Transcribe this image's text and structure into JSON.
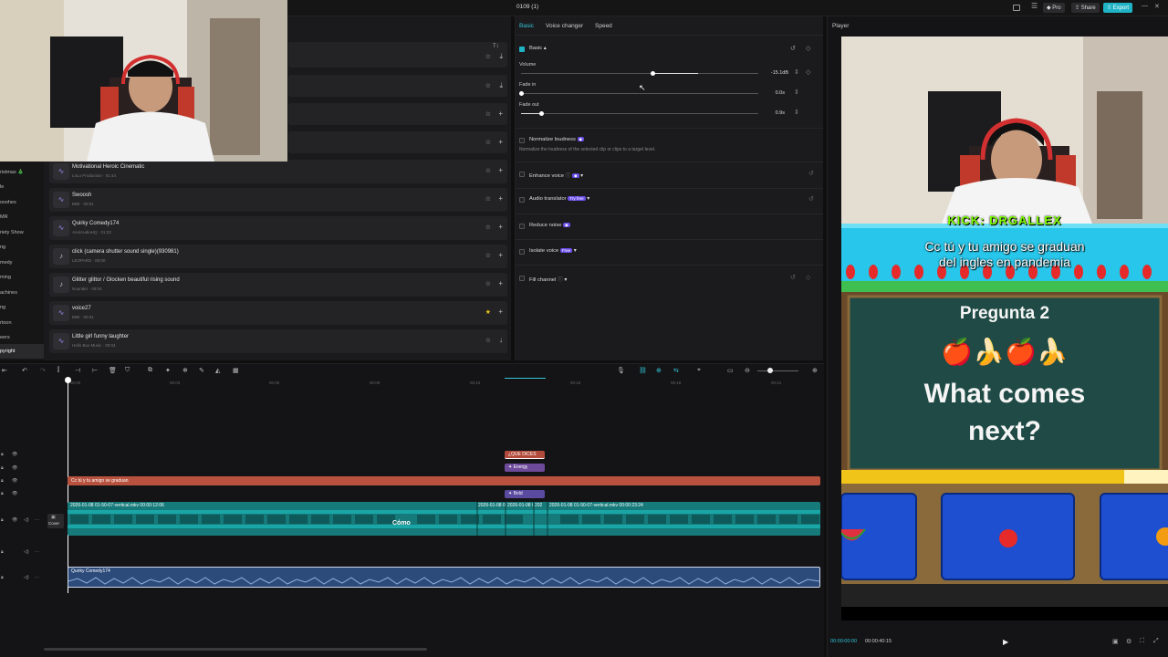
{
  "project": {
    "title": "0109 (1)",
    "pro_label": "Pro",
    "share_label": "Share",
    "export_label": "Export"
  },
  "library": {
    "sort_label": "T↕",
    "categories": [
      "ristmas",
      "le",
      "ooshes",
      "MR",
      "riety Show",
      "ng",
      "medy",
      "ming",
      "achines",
      "ng",
      "rtoon",
      "eers",
      "pyright"
    ],
    "christmas_suffix": "🎄",
    "items": [
      {
        "name": "Motivational Heroic Cinematic",
        "meta": "LoLo Production · 01:44",
        "starred": false,
        "action": "+"
      },
      {
        "name": "Swoosh",
        "meta": "BIBI · 00:01",
        "starred": false,
        "action": "+"
      },
      {
        "name": "Quirky Comedy174",
        "meta": "AnotAudioHQ · 01:23",
        "starred": false,
        "action": "+"
      },
      {
        "name": "click (camera shutter sound single)(930981)",
        "meta": "LEOPARD · 00:00",
        "starred": false,
        "action": "+"
      },
      {
        "name": "Glitter glittor / Glocken beautiful rising sound",
        "meta": "Nounder · 00:04",
        "starred": false,
        "action": "+"
      },
      {
        "name": "voice27",
        "meta": "BIBI · 00:01",
        "starred": true,
        "action": "+"
      },
      {
        "name": "Little girl funny laughter",
        "meta": "Hello Box Music · 00:04",
        "starred": false,
        "action": "↓"
      }
    ]
  },
  "props": {
    "tabs": [
      "Basic",
      "Voice changer",
      "Speed"
    ],
    "basic_label": "Basic",
    "volume": {
      "label": "Volume",
      "value": "-15.1dB",
      "level": 0.45
    },
    "fade_in": {
      "label": "Fade in",
      "value": "0.0s",
      "level": 0.0
    },
    "fade_out": {
      "label": "Fade out",
      "value": "0.9s",
      "level": 0.09
    },
    "normalize": {
      "label": "Normalize loudness",
      "desc": "Normalize the loudness of the selected clip or clips to a target level."
    },
    "enhance": {
      "label": "Enhance voice"
    },
    "translator": {
      "label": "Audio translator",
      "badge": "Try free"
    },
    "reduce": {
      "label": "Reduce noise"
    },
    "isolate": {
      "label": "Isolate voice",
      "badge": "Free"
    },
    "fill": {
      "label": "Fill channel"
    }
  },
  "player": {
    "title": "Player",
    "current_time": "00:00:00:00",
    "total_time": "00:00:40:15",
    "overlay": {
      "streamer": "KICK: DRGALLEX",
      "caption_line1": "Cc tú y tu amigo se graduan",
      "caption_line2": "del ingles en pandemia",
      "question_label": "Pregunta 2",
      "question_emoji": "🍎🍌🍎🍌",
      "question_line1": "What comes",
      "question_line2": "next?"
    }
  },
  "timeline": {
    "ruler": [
      "00:00",
      "00:03",
      "00:06",
      "00:09",
      "00:12",
      "00:15",
      "00:18",
      "00:21"
    ],
    "clips": {
      "sticker_que_dices": "¿QUE DICES",
      "energy": "Energy",
      "text_caption": "Cc tú y tu amigo se graduan",
      "bold": "Bold",
      "video1_label": "2026-01-08 01-50-07-vertical.mkv  00:00:12:06",
      "video2_label": "2026-01-08 01-5",
      "video3_label": "2026-01-08 01-5",
      "video4_label": "202",
      "video5_label": "2026-01-08 01-50-07-vertical.mkv  00:00:23:24",
      "como_label": "Cómo",
      "cover_label": "Cover",
      "audio_label": "Quirky Comedy174"
    }
  },
  "colors": {
    "accent": "#20b3c6",
    "caption_bar": "#b8523e",
    "video_track": "#167a7a",
    "audio_track": "#2c4a7a"
  }
}
